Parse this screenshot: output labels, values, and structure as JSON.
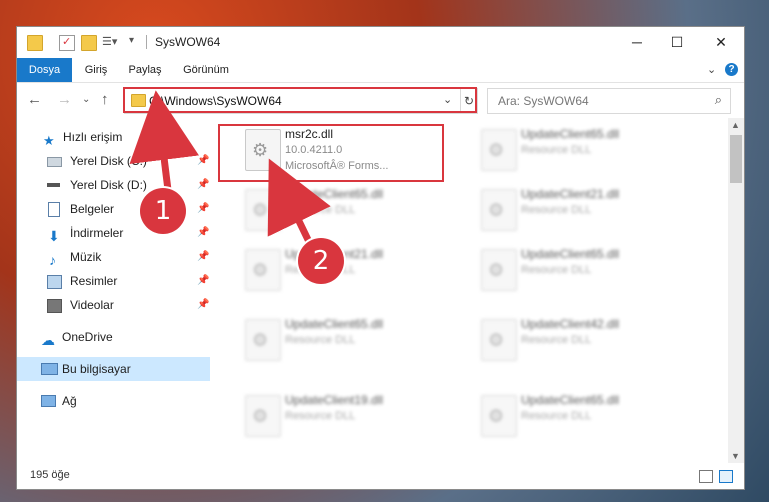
{
  "window": {
    "title": "SysWOW64"
  },
  "ribbon": {
    "tabs": [
      "Dosya",
      "Giriş",
      "Paylaş",
      "Görünüm"
    ],
    "help": "?"
  },
  "address": {
    "path": "C:\\Windows\\SysWOW64",
    "search_placeholder": "Ara: SysWOW64"
  },
  "nav": {
    "quick_access": "Hızlı erişim",
    "items": [
      "Yerel Disk (C:)",
      "Yerel Disk (D:)",
      "Belgeler",
      "İndirmeler",
      "Müzik",
      "Resimler",
      "Videolar"
    ],
    "onedrive": "OneDrive",
    "this_pc": "Bu bilgisayar",
    "network": "Ağ"
  },
  "files": {
    "main": {
      "name": "msr2c.dll",
      "version": "10.0.4211.0",
      "desc": "MicrosoftÂ® Forms..."
    },
    "blurred": [
      {
        "name": "UpdateClient65.dll",
        "desc": "Resource DLL"
      },
      {
        "name": "UpdateClient65.dll",
        "desc": "Resource DLL"
      },
      {
        "name": "UpdateClient21.dll",
        "desc": "Resource DLL"
      },
      {
        "name": "UpdateClient21.dll",
        "desc": "Resource DLL"
      },
      {
        "name": "UpdateClient65.dll",
        "desc": "Resource DLL"
      },
      {
        "name": "UpdateClient65.dll",
        "desc": "Resource DLL"
      },
      {
        "name": "UpdateClient42.dll",
        "desc": "Resource DLL"
      },
      {
        "name": "UpdateClient19.dll",
        "desc": "Resource DLL"
      },
      {
        "name": "UpdateClient65.dll",
        "desc": "Resource DLL"
      }
    ]
  },
  "status": {
    "count": "195 öğe"
  },
  "callouts": [
    "1",
    "2"
  ],
  "colors": {
    "accent": "#1979ca",
    "highlight": "#d9363e",
    "selected_nav": "#cce8ff"
  }
}
